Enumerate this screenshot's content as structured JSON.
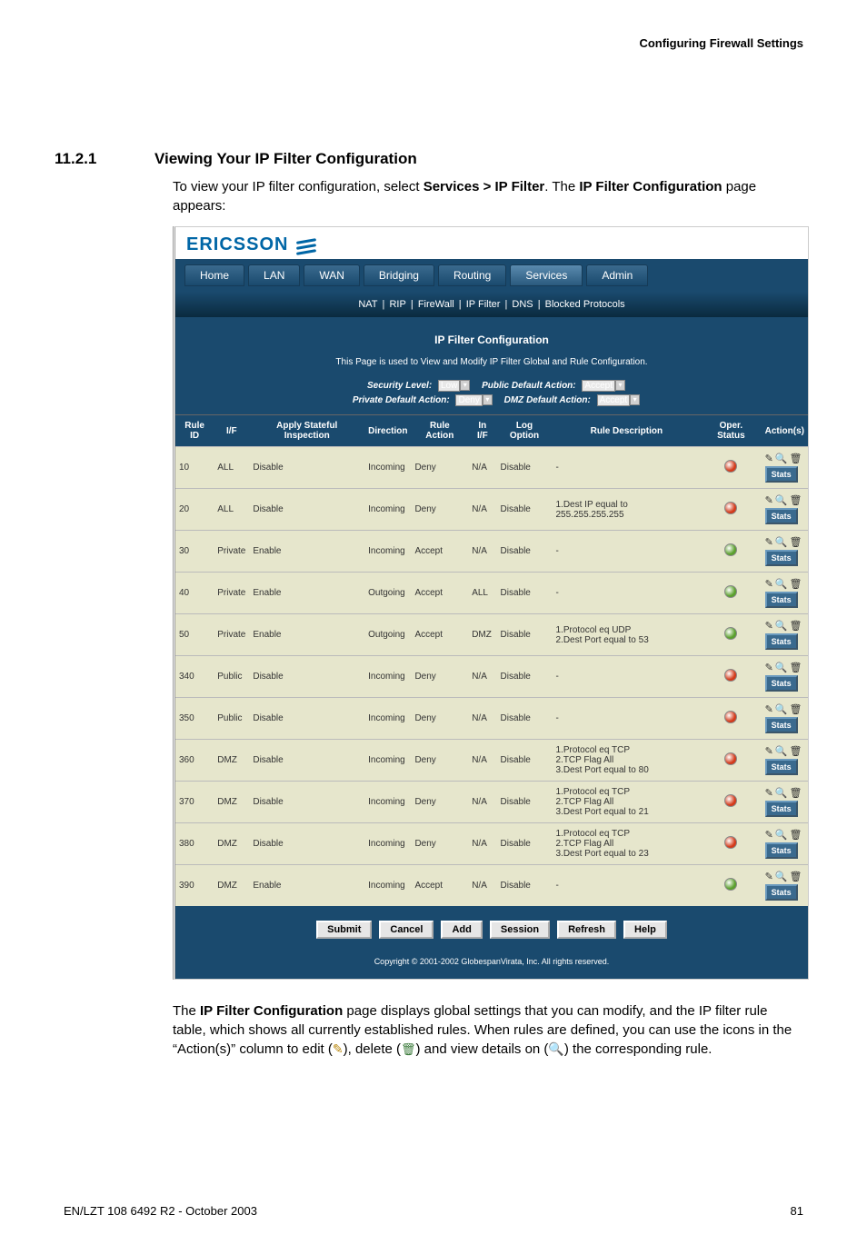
{
  "page_header": "Configuring Firewall Settings",
  "section_number": "11.2.1",
  "section_title": "Viewing Your IP Filter Configuration",
  "intro_prefix": "To view your IP filter configuration, select ",
  "intro_bold1": "Services > IP Filter",
  "intro_mid": ". The ",
  "intro_bold2": "IP Filter Configuration",
  "intro_suffix": " page appears:",
  "logo_text": "ERICSSON",
  "nav_tabs": [
    "Home",
    "LAN",
    "WAN",
    "Bridging",
    "Routing",
    "Services",
    "Admin"
  ],
  "nav_selected": "Services",
  "subnav_items": [
    "NAT",
    "RIP",
    "FireWall",
    "IP Filter",
    "DNS",
    "Blocked Protocols"
  ],
  "cfg_title": "IP Filter Configuration",
  "cfg_subtitle": "This Page is used to View and Modify IP Filter Global and Rule Configuration.",
  "labels": {
    "security_level": "Security Level:",
    "private_default": "Private Default Action:",
    "public_default": "Public Default Action:",
    "dmz_default": "DMZ Default Action:"
  },
  "selects": {
    "security_level": "Low",
    "private_default": "Deny",
    "public_default": "Accept",
    "dmz_default": "Accept"
  },
  "columns": [
    "Rule ID",
    "I/F",
    "Apply Stateful Inspection",
    "Direction",
    "Rule Action",
    "In I/F",
    "Log Option",
    "Rule Description",
    "Oper. Status",
    "Action(s)"
  ],
  "rows": [
    {
      "id": "10",
      "if": "ALL",
      "asi": "Disable",
      "dir": "Incoming",
      "ra": "Deny",
      "inif": "N/A",
      "log": "Disable",
      "desc": "-",
      "status": "red"
    },
    {
      "id": "20",
      "if": "ALL",
      "asi": "Disable",
      "dir": "Incoming",
      "ra": "Deny",
      "inif": "N/A",
      "log": "Disable",
      "desc": "1.Dest IP equal to 255.255.255.255",
      "status": "red"
    },
    {
      "id": "30",
      "if": "Private",
      "asi": "Enable",
      "dir": "Incoming",
      "ra": "Accept",
      "inif": "N/A",
      "log": "Disable",
      "desc": "-",
      "status": "green"
    },
    {
      "id": "40",
      "if": "Private",
      "asi": "Enable",
      "dir": "Outgoing",
      "ra": "Accept",
      "inif": "ALL",
      "log": "Disable",
      "desc": "-",
      "status": "green"
    },
    {
      "id": "50",
      "if": "Private",
      "asi": "Enable",
      "dir": "Outgoing",
      "ra": "Accept",
      "inif": "DMZ",
      "log": "Disable",
      "desc": "1.Protocol eq UDP\n2.Dest Port equal to 53",
      "status": "green"
    },
    {
      "id": "340",
      "if": "Public",
      "asi": "Disable",
      "dir": "Incoming",
      "ra": "Deny",
      "inif": "N/A",
      "log": "Disable",
      "desc": "-",
      "status": "red"
    },
    {
      "id": "350",
      "if": "Public",
      "asi": "Disable",
      "dir": "Incoming",
      "ra": "Deny",
      "inif": "N/A",
      "log": "Disable",
      "desc": "-",
      "status": "red"
    },
    {
      "id": "360",
      "if": "DMZ",
      "asi": "Disable",
      "dir": "Incoming",
      "ra": "Deny",
      "inif": "N/A",
      "log": "Disable",
      "desc": "1.Protocol eq TCP\n2.TCP Flag All\n3.Dest Port equal to 80",
      "status": "red"
    },
    {
      "id": "370",
      "if": "DMZ",
      "asi": "Disable",
      "dir": "Incoming",
      "ra": "Deny",
      "inif": "N/A",
      "log": "Disable",
      "desc": "1.Protocol eq TCP\n2.TCP Flag All\n3.Dest Port equal to 21",
      "status": "red"
    },
    {
      "id": "380",
      "if": "DMZ",
      "asi": "Disable",
      "dir": "Incoming",
      "ra": "Deny",
      "inif": "N/A",
      "log": "Disable",
      "desc": "1.Protocol eq TCP\n2.TCP Flag All\n3.Dest Port equal to 23",
      "status": "red"
    },
    {
      "id": "390",
      "if": "DMZ",
      "asi": "Enable",
      "dir": "Incoming",
      "ra": "Accept",
      "inif": "N/A",
      "log": "Disable",
      "desc": "-",
      "status": "green"
    }
  ],
  "stats_label": "Stats",
  "buttons": [
    "Submit",
    "Cancel",
    "Add",
    "Session",
    "Refresh",
    "Help"
  ],
  "copyright": "Copyright © 2001-2002 GlobespanVirata, Inc. All rights reserved.",
  "after_p1a": "The ",
  "after_p1b": "IP Filter Configuration",
  "after_p1c": " page displays global settings that you can modify, and the IP filter rule table, which shows all currently established rules. When rules are defined, you can use the icons in the “Action(s)” column to edit (",
  "after_p1d": "), delete (",
  "after_p1e": ") and view details on (",
  "after_p1f": ") the corresponding rule.",
  "footer_left": "EN/LZT 108 6492 R2 - October 2003",
  "footer_right": "81"
}
